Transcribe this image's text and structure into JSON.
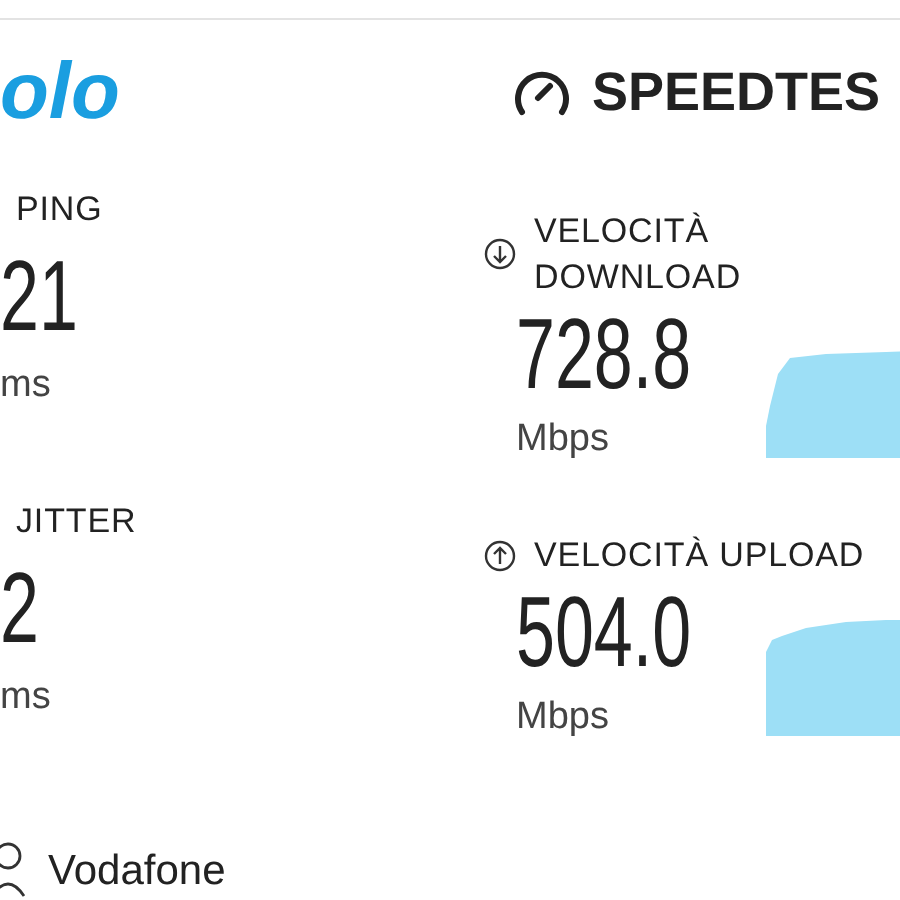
{
  "logo": {
    "text": "olo"
  },
  "header": {
    "title": "SPEEDTES"
  },
  "latency": [
    {
      "label": "PING",
      "value": "21",
      "unit": "ms"
    },
    {
      "label": "JITTER",
      "value": "2",
      "unit": "ms"
    }
  ],
  "speeds": [
    {
      "kind": "download",
      "label": "VELOCITÀ DOWNLOAD",
      "value": "728.8",
      "unit": "Mbps"
    },
    {
      "kind": "upload",
      "label": "VELOCITÀ UPLOAD",
      "value": "504.0",
      "unit": "Mbps"
    }
  ],
  "provider": {
    "name": "Vodafone"
  }
}
